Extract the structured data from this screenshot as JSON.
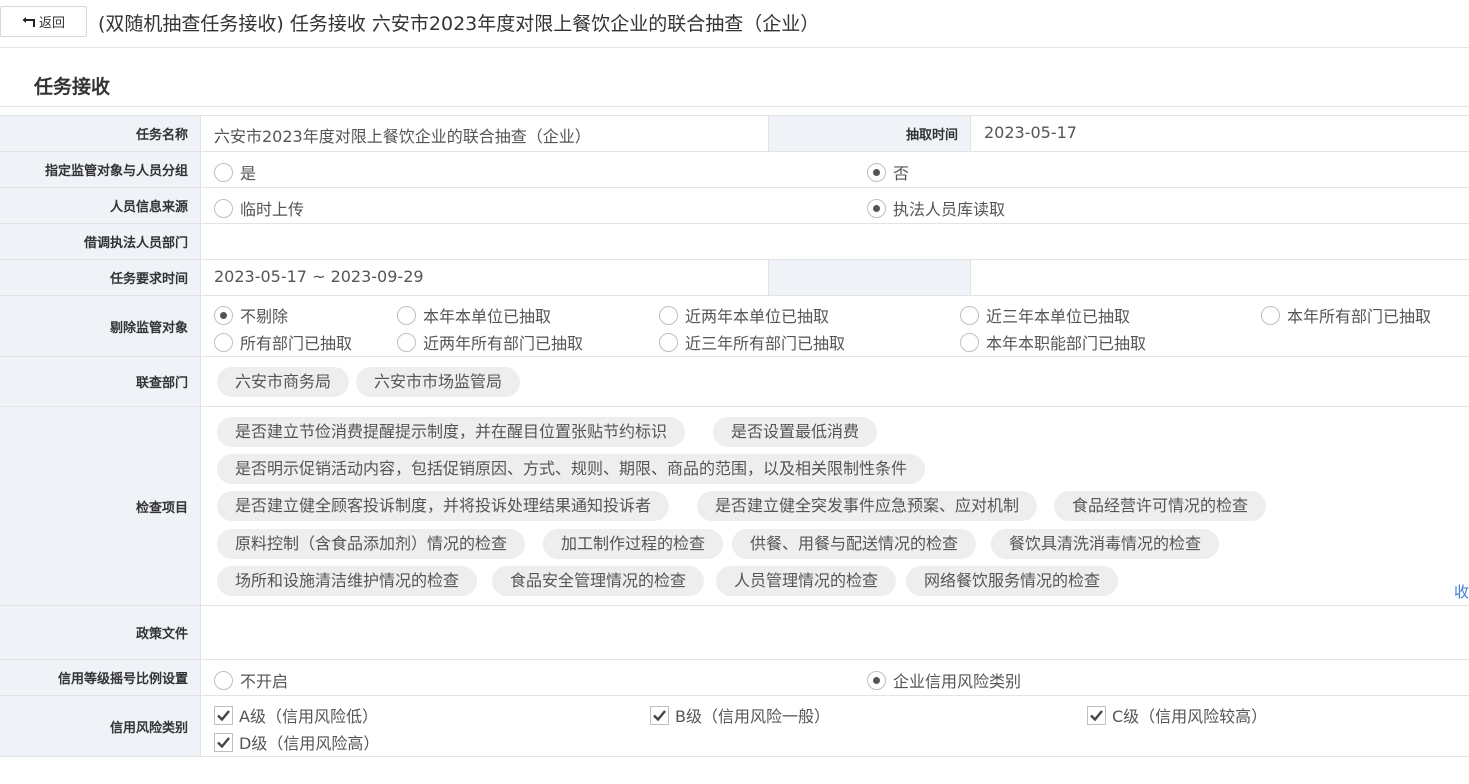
{
  "header": {
    "back_label": "返回",
    "title": "(双随机抽查任务接收) 任务接收 六安市2023年度对限上餐饮企业的联合抽查（企业）"
  },
  "section": {
    "title": "任务接收"
  },
  "form": {
    "task_name": {
      "label": "任务名称",
      "value": "六安市2023年度对限上餐饮企业的联合抽查（企业）"
    },
    "draw_time": {
      "label": "抽取时间",
      "value": "2023-05-17"
    },
    "assign_group": {
      "label": "指定监管对象与人员分组",
      "options": [
        "是",
        "否"
      ],
      "selected": "否"
    },
    "staff_source": {
      "label": "人员信息来源",
      "options": [
        "临时上传",
        "执法人员库读取"
      ],
      "selected": "执法人员库读取"
    },
    "borrow_dept": {
      "label": "借调执法人员部门",
      "value": ""
    },
    "required_time": {
      "label": "任务要求时间",
      "value": "2023-05-17 ~ 2023-09-29"
    },
    "exclude": {
      "label": "剔除监管对象",
      "options": [
        "不剔除",
        "本年本单位已抽取",
        "近两年本单位已抽取",
        "近三年本单位已抽取",
        "本年所有部门已抽取",
        "所有部门已抽取",
        "近两年所有部门已抽取",
        "近三年所有部门已抽取",
        "本年本职能部门已抽取"
      ],
      "selected": "不剔除"
    },
    "joint_depts": {
      "label": "联查部门",
      "tags": [
        "六安市商务局",
        "六安市市场监管局"
      ]
    },
    "check_items": {
      "label": "检查项目",
      "tags": [
        "是否建立节俭消费提醒提示制度，并在醒目位置张贴节约标识",
        "是否设置最低消费",
        "是否明示促销活动内容，包括促销原因、方式、规则、期限、商品的范围，以及相关限制性条件",
        "是否建立健全顾客投诉制度，并将投诉处理结果通知投诉者",
        "是否建立健全突发事件应急预案、应对机制",
        "食品经营许可情况的检查",
        "原料控制（含食品添加剂）情况的检查",
        "加工制作过程的检查",
        "供餐、用餐与配送情况的检查",
        "餐饮具清洗消毒情况的检查",
        "场所和设施清洁维护情况的检查",
        "食品安全管理情况的检查",
        "人员管理情况的检查",
        "网络餐饮服务情况的检查"
      ],
      "collapse_label": "收"
    },
    "policy": {
      "label": "政策文件",
      "value": ""
    },
    "credit_ratio": {
      "label": "信用等级摇号比例设置",
      "options": [
        "不开启",
        "企业信用风险类别"
      ],
      "selected": "企业信用风险类别"
    },
    "credit_risk": {
      "label": "信用风险类别",
      "options": [
        "A级（信用风险低）",
        "B级（信用风险一般）",
        "C级（信用风险较高）",
        "D级（信用风险高）"
      ],
      "checked": [
        true,
        true,
        true,
        true
      ]
    }
  }
}
